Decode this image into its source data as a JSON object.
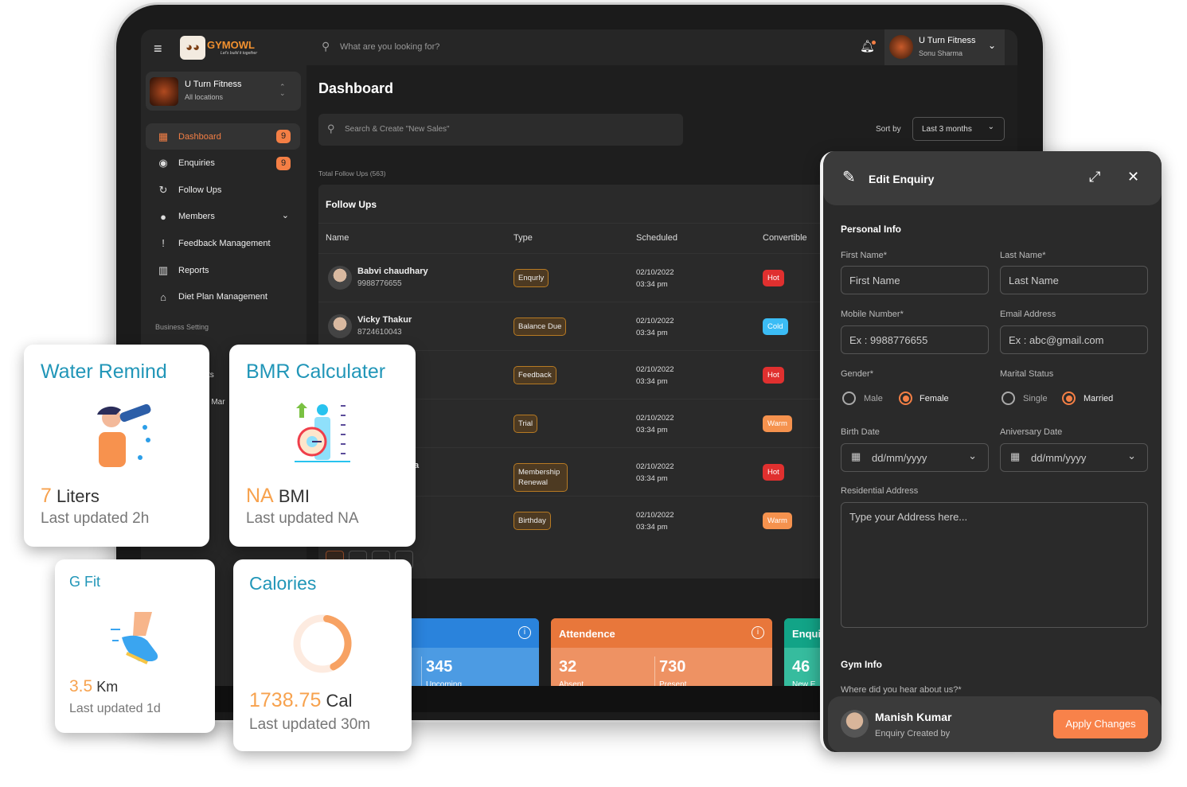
{
  "app": {
    "logo_text": "GYMOWL",
    "logo_tagline": "Let's build it together"
  },
  "topbar": {
    "search_placeholder": "What are you looking for?",
    "profile_name": "U Turn Fitness",
    "profile_user": "Sonu Sharma"
  },
  "location": {
    "name": "U Turn Fitness",
    "sub": "All locations"
  },
  "sidebar": {
    "items": [
      {
        "label": "Dashboard",
        "icon": "dashboard-icon",
        "badge": "9",
        "active": true
      },
      {
        "label": "Enquiries",
        "icon": "enquiries-icon",
        "badge": "9"
      },
      {
        "label": "Follow Ups",
        "icon": "follow-ups-icon"
      },
      {
        "label": "Members",
        "icon": "members-icon"
      },
      {
        "label": "Feedback Management",
        "icon": "feedback-icon"
      },
      {
        "label": "Reports",
        "icon": "reports-icon"
      },
      {
        "label": "Diet Plan Management",
        "icon": "diet-icon"
      }
    ],
    "section": "Business Setting",
    "hidden_item_1": "ts",
    "hidden_item_2": "e Mar"
  },
  "main": {
    "title": "Dashboard",
    "search_placeholder": "Search & Create \"New Sales\"",
    "sort_label": "Sort by",
    "sort_value": "Last 3 months",
    "total": "Total Follow Ups (563)"
  },
  "followups": {
    "title": "Follow Ups",
    "columns": [
      "Name",
      "Type",
      "Scheduled",
      "Convertible"
    ],
    "rows": [
      {
        "name": "Babvi chaudhary",
        "phone": "9988776655",
        "type": "Enqurly",
        "date": "02/10/2022",
        "time": "03:34 pm",
        "conv": "Hot"
      },
      {
        "name": "Vicky Thakur",
        "phone": "8724610043",
        "type": "Balance Due",
        "date": "02/10/2022",
        "time": "03:34 pm",
        "conv": "Cold"
      },
      {
        "name": "",
        "phone": "",
        "type": "Feedback",
        "date": "02/10/2022",
        "time": "03:34 pm",
        "conv": "Hot"
      },
      {
        "name": "",
        "phone": "",
        "type": "Trial",
        "date": "02/10/2022",
        "time": "03:34 pm",
        "conv": "Warm"
      },
      {
        "name": "a",
        "phone": "",
        "type": "Membership Renewal",
        "date": "02/10/2022",
        "time": "03:34 pm",
        "conv": "Hot"
      },
      {
        "name": "",
        "phone": "",
        "type": "Birthday",
        "date": "02/10/2022",
        "time": "03:34 pm",
        "conv": "Warm"
      }
    ]
  },
  "conv_colors": {
    "Hot": "#e0302f",
    "Cold": "#3bbcf5",
    "Warm": "#f5924e"
  },
  "stats": {
    "blue": {
      "value": "345",
      "label": "Upcoming"
    },
    "attendance": {
      "title": "Attendence",
      "absent": "32",
      "absent_label": "Absent",
      "present": "730",
      "present_label": "Present"
    },
    "enquiry": {
      "title": "Enqui",
      "value": "46",
      "label": "New E"
    }
  },
  "panel": {
    "title": "Edit Enquiry",
    "personal": "Personal Info",
    "first_label": "First Name*",
    "first_ph": "First Name",
    "last_label": "Last Name*",
    "last_ph": "Last Name",
    "mobile_label": "Mobile Number*",
    "mobile_ph": "Ex : 9988776655",
    "email_label": "Email Address",
    "email_ph": "Ex : abc@gmail.com",
    "gender_label": "Gender*",
    "male": "Male",
    "female": "Female",
    "marital_label": "Marital Status",
    "single": "Single",
    "married": "Married",
    "birth_label": "Birth Date",
    "anniv_label": "Aniversary Date",
    "date_ph": "dd/mm/yyyy",
    "address_label": "Residential Address",
    "address_ph": "Type your Address here...",
    "gym": "Gym Info",
    "hear_label": "Where did you hear about us?*",
    "creator": "Manish Kumar",
    "creator_sub": "Enquiry Created by",
    "apply": "Apply Changes"
  },
  "widgets": {
    "water": {
      "title": "Water Remind",
      "value": "7",
      "unit": "Liters",
      "updated": "Last updated 2h"
    },
    "bmr": {
      "title": "BMR Calculater",
      "value": "NA",
      "unit": "BMI",
      "updated": "Last updated NA"
    },
    "gfit": {
      "title": "G Fit",
      "value": "3.5",
      "unit": "Km",
      "updated": "Last updated 1d"
    },
    "calories": {
      "title": "Calories",
      "value": "1738.75",
      "unit": "Cal",
      "updated": "Last updated 30m",
      "progress": 0.4
    }
  }
}
